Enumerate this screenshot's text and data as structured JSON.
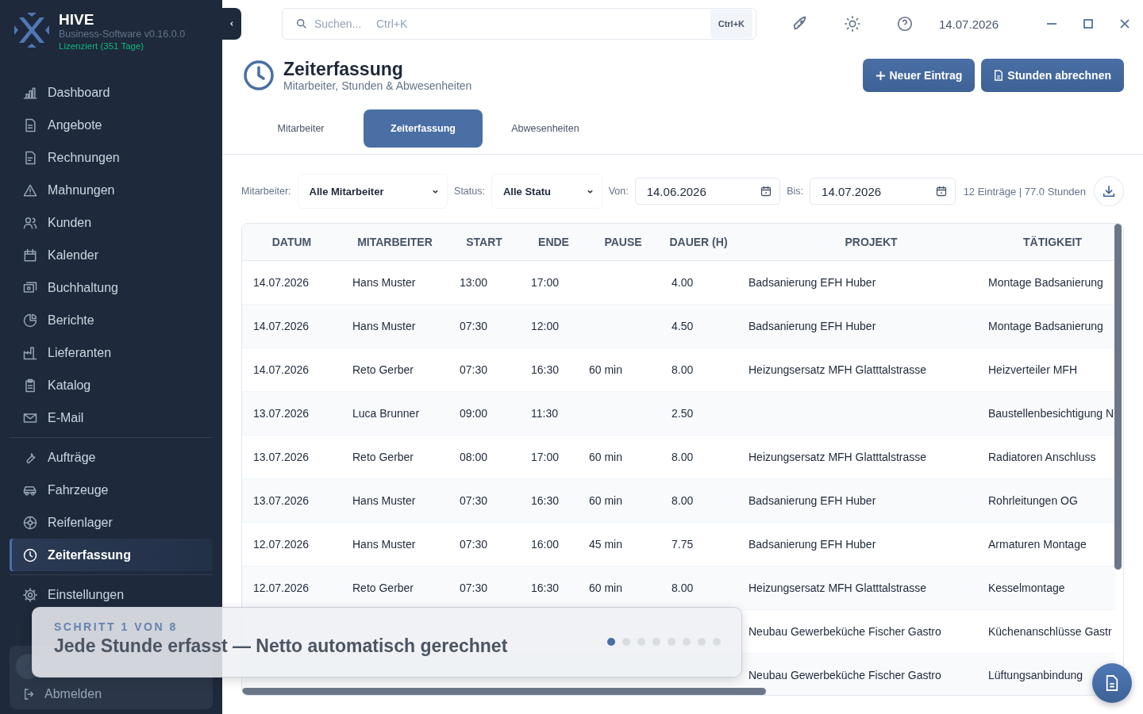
{
  "app": {
    "name": "HIVE",
    "version": "Business-Software v0.16.0.0",
    "license": "Lizenziert (351 Tage)"
  },
  "sidebar": {
    "sections": [
      {
        "items": [
          {
            "label": "Dashboard",
            "selected": false
          },
          {
            "label": "Angebote",
            "selected": false
          },
          {
            "label": "Rechnungen",
            "selected": false
          },
          {
            "label": "Mahnungen",
            "selected": false
          },
          {
            "label": "Kunden",
            "selected": false
          },
          {
            "label": "Kalender",
            "selected": false
          },
          {
            "label": "Buchhaltung",
            "selected": false
          },
          {
            "label": "Berichte",
            "selected": false
          },
          {
            "label": "Lieferanten",
            "selected": false
          },
          {
            "label": "Katalog",
            "selected": false
          },
          {
            "label": "E-Mail",
            "selected": false
          }
        ]
      },
      {
        "items": [
          {
            "label": "Aufträge",
            "selected": false
          },
          {
            "label": "Fahrzeuge",
            "selected": false
          },
          {
            "label": "Reifenlager",
            "selected": false
          },
          {
            "label": "Zeiterfassung",
            "selected": true
          }
        ]
      },
      {
        "items": [
          {
            "label": "Einstellungen",
            "selected": false
          }
        ]
      }
    ],
    "user": {
      "logout": "Abmelden"
    }
  },
  "topbar": {
    "search": {
      "placeholder": "Suchen...",
      "hint": "Ctrl+K",
      "shortcut": "Ctrl+K"
    },
    "date": "14.07.2026"
  },
  "page": {
    "title": "Zeiterfassung",
    "subtitle": "Mitarbeiter, Stunden & Abwesenheiten",
    "actions": [
      "Neuer Eintrag",
      "Stunden abrechnen"
    ]
  },
  "tabs": [
    {
      "label": "Mitarbeiter",
      "selected": false
    },
    {
      "label": "Zeiterfassung",
      "selected": true
    },
    {
      "label": "Abwesenheiten",
      "selected": false
    }
  ],
  "filters": [
    {
      "kind": "select",
      "label": "Mitarbeiter:",
      "value": "Alle Mitarbeiter"
    },
    {
      "kind": "select",
      "label": "Status:",
      "value": "Alle Statu"
    },
    {
      "kind": "date",
      "label": "Von:",
      "value": "14.06.2026"
    },
    {
      "kind": "date",
      "label": "Bis:",
      "value": "14.07.2026"
    }
  ],
  "summary": "12 Einträge | 77.0 Stunden",
  "table": {
    "columns": [
      "DATUM",
      "MITARBEITER",
      "START",
      "ENDE",
      "PAUSE",
      "DAUER (H)",
      "PROJEKT",
      "TÄTIGKEIT"
    ],
    "rows": [
      [
        "14.07.2026",
        "Hans Muster",
        "13:00",
        "17:00",
        "",
        "4.00",
        "Badsanierung EFH Huber",
        "Montage Badsanierung"
      ],
      [
        "14.07.2026",
        "Hans Muster",
        "07:30",
        "12:00",
        "",
        "4.50",
        "Badsanierung EFH Huber",
        "Montage Badsanierung"
      ],
      [
        "14.07.2026",
        "Reto Gerber",
        "07:30",
        "16:30",
        "60 min",
        "8.00",
        "Heizungsersatz MFH Glatttalstrasse",
        "Heizverteiler MFH"
      ],
      [
        "13.07.2026",
        "Luca Brunner",
        "09:00",
        "11:30",
        "",
        "2.50",
        "",
        "Baustellenbesichtigung N"
      ],
      [
        "13.07.2026",
        "Reto Gerber",
        "08:00",
        "17:00",
        "60 min",
        "8.00",
        "Heizungsersatz MFH Glatttalstrasse",
        "Radiatoren Anschluss"
      ],
      [
        "13.07.2026",
        "Hans Muster",
        "07:30",
        "16:30",
        "60 min",
        "8.00",
        "Badsanierung EFH Huber",
        "Rohrleitungen OG"
      ],
      [
        "12.07.2026",
        "Hans Muster",
        "07:30",
        "16:00",
        "45 min",
        "7.75",
        "Badsanierung EFH Huber",
        "Armaturen Montage"
      ],
      [
        "12.07.2026",
        "Reto Gerber",
        "07:30",
        "16:30",
        "60 min",
        "8.00",
        "Heizungsersatz MFH Glatttalstrasse",
        "Kesselmontage"
      ],
      [
        null,
        null,
        null,
        null,
        null,
        null,
        "Neubau Gewerbeküche Fischer Gastro",
        "Küchenanschlüsse Gastr"
      ],
      [
        null,
        null,
        null,
        null,
        null,
        null,
        "Neubau Gewerbeküche Fischer Gastro",
        "Lüftungsanbindung"
      ]
    ]
  },
  "tour": {
    "step": "SCHRITT 1 VON 8",
    "title": "Jede Stunde erfasst — Netto automatisch gerechnet",
    "dots": [
      {
        "selected": true
      },
      {
        "selected": false
      },
      {
        "selected": false
      },
      {
        "selected": false
      },
      {
        "selected": false
      },
      {
        "selected": false
      },
      {
        "selected": false
      },
      {
        "selected": false
      }
    ]
  }
}
